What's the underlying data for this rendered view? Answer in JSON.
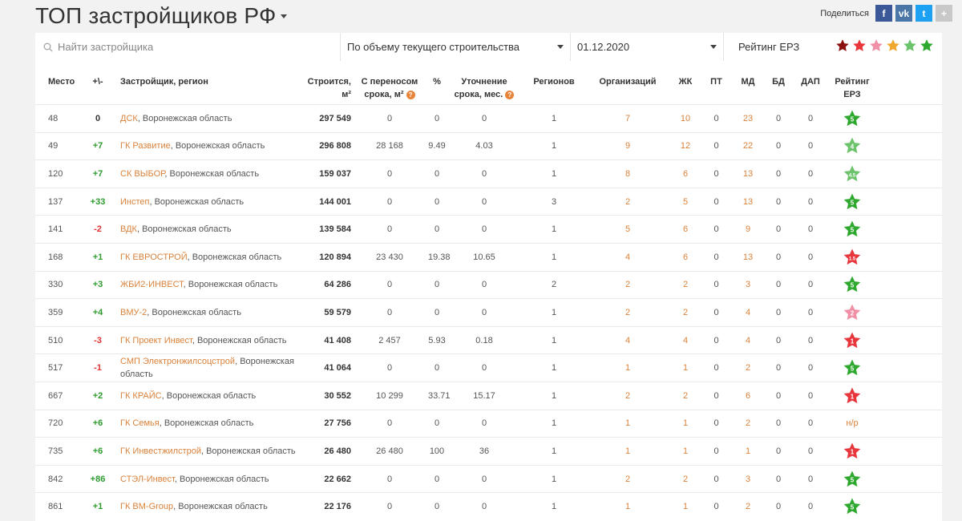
{
  "header": {
    "title": "ТОП застройщиков РФ",
    "share_label": "Поделиться"
  },
  "share_buttons": [
    {
      "icon": "facebook-icon",
      "glyph": "f",
      "color": "#3b5998"
    },
    {
      "icon": "vk-icon",
      "glyph": "vk",
      "color": "#4a76a8"
    },
    {
      "icon": "twitter-icon",
      "glyph": "t",
      "color": "#1da1f2"
    },
    {
      "icon": "plus-icon",
      "glyph": "+",
      "color": "#c8c8c8"
    }
  ],
  "filters": {
    "search_placeholder": "Найти застройщика",
    "sort_by": "По объему текущего строительства",
    "date": "01.12.2020",
    "rating_label": "Рейтинг ЕРЗ",
    "rating_stars": [
      "#8b1010",
      "#e8373c",
      "#f08fa5",
      "#f0a830",
      "#6cc36c",
      "#2ea82e"
    ]
  },
  "columns": {
    "place": "Место",
    "delta": "+\\-",
    "developer": "Застройщик, регион",
    "builds": "Строится, м²",
    "transfer_1": "С переносом",
    "transfer_2": "срока, м²",
    "percent": "%",
    "clarify_1": "Уточнение",
    "clarify_2": "срока, мес.",
    "regions": "Регионов",
    "orgs": "Организаций",
    "zhk": "ЖК",
    "pt": "ПТ",
    "md": "МД",
    "bd": "БД",
    "dap": "ДАП",
    "rating_1": "Рейтинг",
    "rating_2": "ЕРЗ"
  },
  "rows": [
    {
      "place": "48",
      "delta": "0",
      "name": "ДСК",
      "region": ", Воронежская область",
      "builds": "297 549",
      "transfer": "0",
      "percent": "0",
      "clarify": "0",
      "regions": "1",
      "orgs": "7",
      "zhk": "10",
      "pt": "0",
      "md": "23",
      "bd": "0",
      "dap": "0",
      "rating": "5",
      "star_color": "#2ea82e"
    },
    {
      "place": "49",
      "delta": "+7",
      "name": "ГК Развитие",
      "region": ", Воронежская область",
      "builds": "296 808",
      "transfer": "28 168",
      "percent": "9.49",
      "clarify": "4.03",
      "regions": "1",
      "orgs": "9",
      "zhk": "12",
      "pt": "0",
      "md": "22",
      "bd": "0",
      "dap": "0",
      "rating": "4",
      "star_color": "#6cc36c"
    },
    {
      "place": "120",
      "delta": "+7",
      "name": "СК ВЫБОР",
      "region": ", Воронежская область",
      "builds": "159 037",
      "transfer": "0",
      "percent": "0",
      "clarify": "0",
      "regions": "1",
      "orgs": "8",
      "zhk": "6",
      "pt": "0",
      "md": "13",
      "bd": "0",
      "dap": "0",
      "rating": "4.5",
      "star_color": "#6cc36c"
    },
    {
      "place": "137",
      "delta": "+33",
      "name": "Инстеп",
      "region": ", Воронежская область",
      "builds": "144 001",
      "transfer": "0",
      "percent": "0",
      "clarify": "0",
      "regions": "3",
      "orgs": "2",
      "zhk": "5",
      "pt": "0",
      "md": "13",
      "bd": "0",
      "dap": "0",
      "rating": "5",
      "star_color": "#2ea82e"
    },
    {
      "place": "141",
      "delta": "-2",
      "name": "ВДК",
      "region": ", Воронежская область",
      "builds": "139 584",
      "transfer": "0",
      "percent": "0",
      "clarify": "0",
      "regions": "1",
      "orgs": "5",
      "zhk": "6",
      "pt": "0",
      "md": "9",
      "bd": "0",
      "dap": "0",
      "rating": "5",
      "star_color": "#2ea82e"
    },
    {
      "place": "168",
      "delta": "+1",
      "name": "ГК ЕВРОСТРОЙ",
      "region": ", Воронежская область",
      "builds": "120 894",
      "transfer": "23 430",
      "percent": "19.38",
      "clarify": "10.65",
      "regions": "1",
      "orgs": "4",
      "zhk": "6",
      "pt": "0",
      "md": "13",
      "bd": "0",
      "dap": "0",
      "rating": "1.5",
      "star_color": "#e8373c"
    },
    {
      "place": "330",
      "delta": "+3",
      "name": "ЖБИ2-ИНВЕСТ",
      "region": ", Воронежская область",
      "builds": "64 286",
      "transfer": "0",
      "percent": "0",
      "clarify": "0",
      "regions": "2",
      "orgs": "2",
      "zhk": "2",
      "pt": "0",
      "md": "3",
      "bd": "0",
      "dap": "0",
      "rating": "5",
      "star_color": "#2ea82e"
    },
    {
      "place": "359",
      "delta": "+4",
      "name": "ВМУ-2",
      "region": ", Воронежская область",
      "builds": "59 579",
      "transfer": "0",
      "percent": "0",
      "clarify": "0",
      "regions": "1",
      "orgs": "2",
      "zhk": "2",
      "pt": "0",
      "md": "4",
      "bd": "0",
      "dap": "0",
      "rating": "2",
      "star_color": "#f08fa5"
    },
    {
      "place": "510",
      "delta": "-3",
      "name": "ГК Проект Инвест",
      "region": ", Воронежская область",
      "builds": "41 408",
      "transfer": "2 457",
      "percent": "5.93",
      "clarify": "0.18",
      "regions": "1",
      "orgs": "4",
      "zhk": "4",
      "pt": "0",
      "md": "4",
      "bd": "0",
      "dap": "0",
      "rating": "1",
      "star_color": "#e8373c"
    },
    {
      "place": "517",
      "delta": "-1",
      "name": "СМП Электронжилсоцстрой",
      "region": ", Воронежская область",
      "builds": "41 064",
      "transfer": "0",
      "percent": "0",
      "clarify": "0",
      "regions": "1",
      "orgs": "1",
      "zhk": "1",
      "pt": "0",
      "md": "2",
      "bd": "0",
      "dap": "0",
      "rating": "5",
      "star_color": "#2ea82e"
    },
    {
      "place": "667",
      "delta": "+2",
      "name": "ГК КРАЙС",
      "region": ", Воронежская область",
      "builds": "30 552",
      "transfer": "10 299",
      "percent": "33.71",
      "clarify": "15.17",
      "regions": "1",
      "orgs": "2",
      "zhk": "2",
      "pt": "0",
      "md": "6",
      "bd": "0",
      "dap": "0",
      "rating": "1",
      "star_color": "#e8373c"
    },
    {
      "place": "720",
      "delta": "+6",
      "name": "ГК Семья",
      "region": ", Воронежская область",
      "builds": "27 756",
      "transfer": "0",
      "percent": "0",
      "clarify": "0",
      "regions": "1",
      "orgs": "1",
      "zhk": "1",
      "pt": "0",
      "md": "2",
      "bd": "0",
      "dap": "0",
      "rating": "н/р",
      "star_color": ""
    },
    {
      "place": "735",
      "delta": "+6",
      "name": "ГК Инвестжилстрой",
      "region": ", Воронежская область",
      "builds": "26 480",
      "transfer": "26 480",
      "percent": "100",
      "clarify": "36",
      "regions": "1",
      "orgs": "1",
      "zhk": "1",
      "pt": "0",
      "md": "1",
      "bd": "0",
      "dap": "0",
      "rating": "1",
      "star_color": "#e8373c"
    },
    {
      "place": "842",
      "delta": "+86",
      "name": "СТЭЛ-Инвест",
      "region": ", Воронежская область",
      "builds": "22 662",
      "transfer": "0",
      "percent": "0",
      "clarify": "0",
      "regions": "1",
      "orgs": "2",
      "zhk": "2",
      "pt": "0",
      "md": "3",
      "bd": "0",
      "dap": "0",
      "rating": "5",
      "star_color": "#2ea82e"
    },
    {
      "place": "861",
      "delta": "+1",
      "name": "ГК ВМ-Group",
      "region": ", Воронежская область",
      "builds": "22 176",
      "transfer": "0",
      "percent": "0",
      "clarify": "0",
      "regions": "1",
      "orgs": "1",
      "zhk": "1",
      "pt": "0",
      "md": "2",
      "bd": "0",
      "dap": "0",
      "rating": "5",
      "star_color": "#2ea82e"
    }
  ]
}
